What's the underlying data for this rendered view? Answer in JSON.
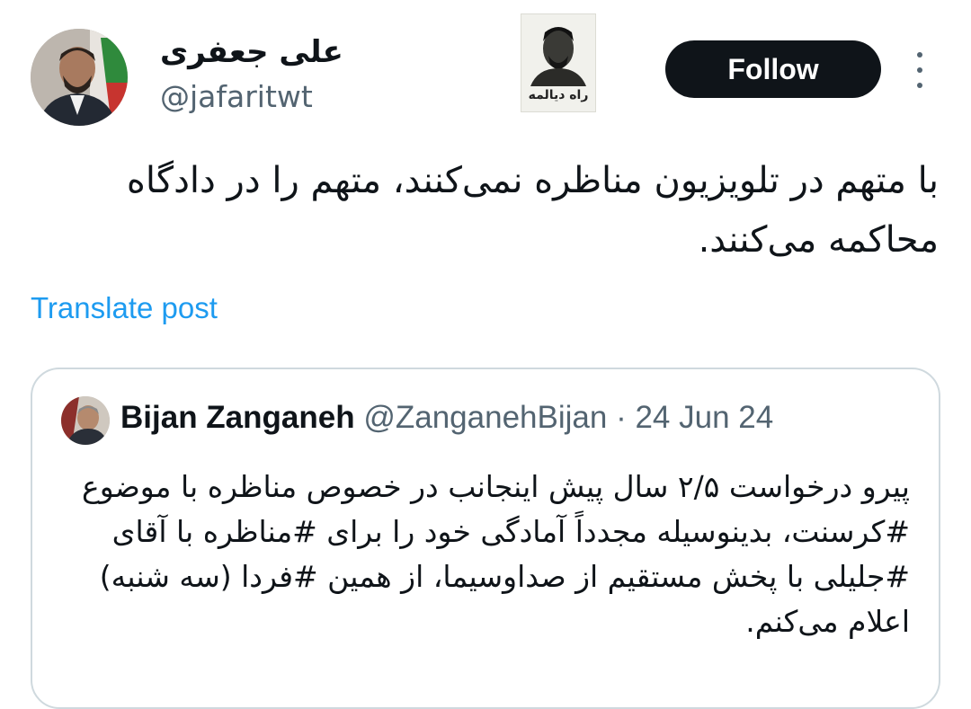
{
  "author": {
    "display_name": "علی جعفری",
    "handle": "@jafaritwt",
    "badge_caption": "راه دیالمه"
  },
  "actions": {
    "follow_label": "Follow",
    "more_icon": "more-vertical-icon"
  },
  "post": {
    "text": "با متهم در تلویزیون مناظره نمی‌کنند، متهم را در دادگاه محاکمه می‌کنند.",
    "translate_label": "Translate post"
  },
  "quoted": {
    "name": "Bijan Zanganeh",
    "handle": "@ZanganehBijan",
    "separator": "·",
    "date": "24 Jun 24",
    "text": "پیرو درخواست ۲/۵ سال پیش اینجانب در خصوص مناظره با موضوع #کرسنت، بدینوسیله مجدداً آمادگی خود را برای #مناظره با آقای #جلیلی با پخش مستقیم از صداوسیما، از همین #فردا (سه شنبه) اعلام می‌کنم."
  },
  "colors": {
    "text": "#0f1419",
    "muted": "#536471",
    "link": "#1d9bf0",
    "follow_bg": "#0f1419",
    "border": "#cfd9de"
  }
}
